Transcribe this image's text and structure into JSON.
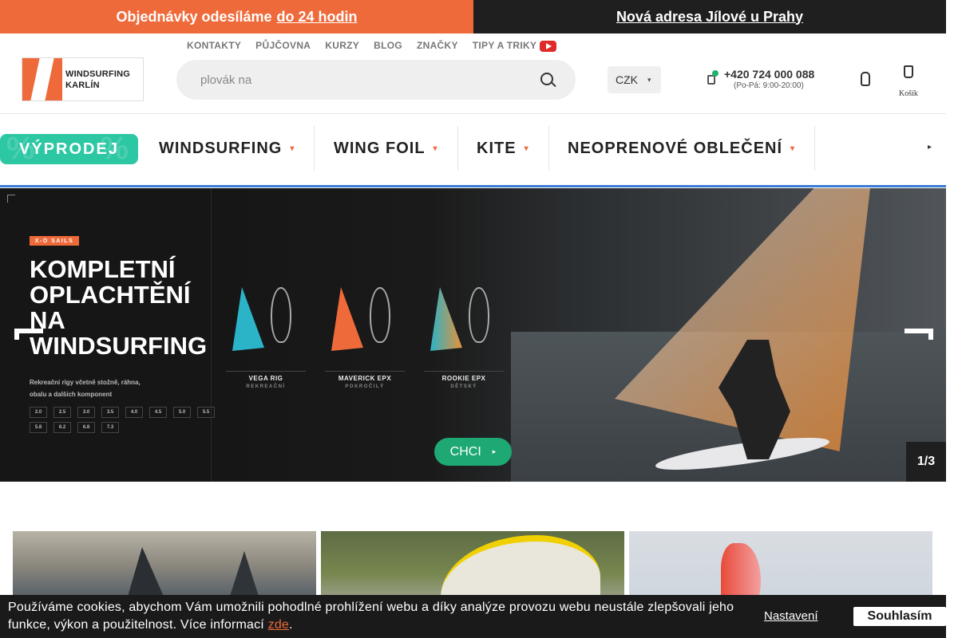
{
  "announce": {
    "left_prefix": "Objednávky odesíláme",
    "left_highlight": "do 24 hodin",
    "right": "Nová adresa Jílové u Prahy"
  },
  "header": {
    "logo_line1": "WINDSURFING",
    "logo_line2": "KARLÍN",
    "topnav": [
      "KONTAKTY",
      "PŮJČOVNA",
      "KURZY",
      "BLOG",
      "ZNAČKY",
      "TIPY A TRIKY"
    ],
    "search_placeholder": "plovák na",
    "currency": "CZK",
    "phone": "+420 724 000 088",
    "hours": "(Po-Pá: 9:00-20:00)",
    "cart_label": "Košík"
  },
  "mainnav": {
    "sale": "VÝPRODEJ",
    "items": [
      "WINDSURFING",
      "WING FOIL",
      "KITE",
      "NEOPRENOVÉ OBLEČENÍ"
    ]
  },
  "hero": {
    "brand": "X-O SAILS",
    "title_lines": [
      "KOMPLETNÍ",
      "OPLACHTĚNÍ",
      "NA",
      "WINDSURFING"
    ],
    "subtitle_line1": "Rekreační rigy včetně stožně, ráhna,",
    "subtitle_line2": "obalu a dalších komponent",
    "sizes": [
      "2.0",
      "2.5",
      "3.0",
      "3.5",
      "4.0",
      "4.5",
      "5.0",
      "5.5",
      "5.8",
      "6.2",
      "6.8",
      "7.3"
    ],
    "rigs": [
      {
        "name": "VEGA RIG",
        "level": "REKREAČNÍ",
        "color": "#2bb3c8"
      },
      {
        "name": "MAVERICK EPX",
        "level": "POKROČILÝ",
        "color": "#ef6a3a"
      },
      {
        "name": "ROOKIE EPX",
        "level": "DĚTSKÝ",
        "color": "#e7913a"
      }
    ],
    "cta": "CHCI",
    "counter": "1/3"
  },
  "cookie": {
    "text": "Používáme cookies, abychom Vám umožnili pohodlné prohlížení webu a díky analýze provozu webu neustále zlepšovali jeho funkce, výkon a použitelnost. Více informací",
    "link": "zde",
    "settings": "Nastavení",
    "accept": "Souhlasím"
  },
  "colors": {
    "accent_orange": "#ef6a3a",
    "sale_teal": "#2cc7a3",
    "cta_green": "#1ea873",
    "dark": "#1f1f1f"
  }
}
